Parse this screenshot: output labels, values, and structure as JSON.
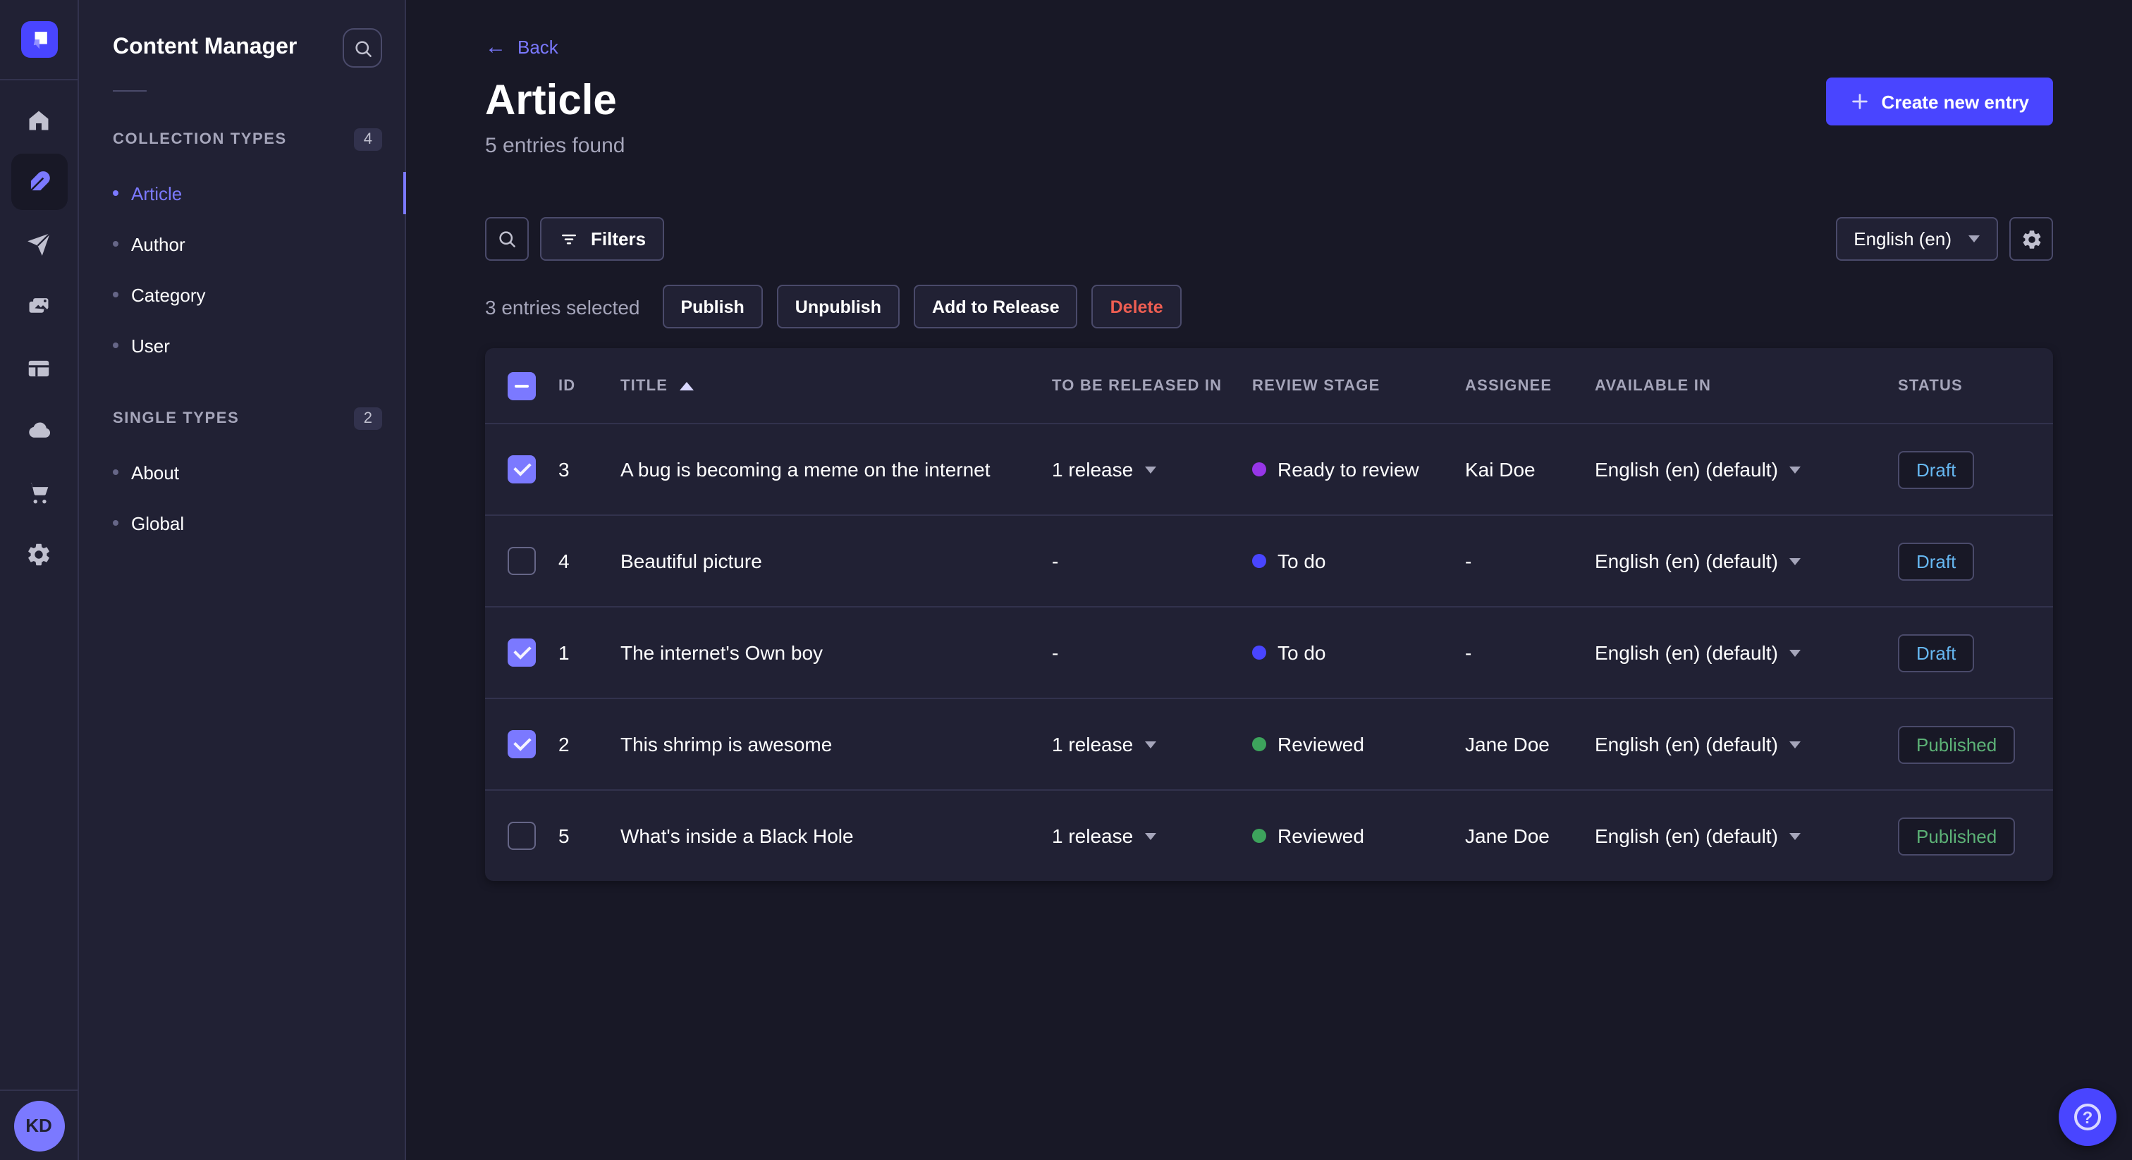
{
  "nav": {
    "logo_icon": "strapi-logo",
    "items": [
      "home-icon",
      "content-manager-feather-icon",
      "releases-paper-plane-icon",
      "media-library-images-icon",
      "content-type-builder-layout-icon",
      "deploy-cloud-icon",
      "marketplace-cart-icon",
      "settings-gear-icon"
    ],
    "active_item": "content-manager-feather-icon",
    "avatar_initials": "KD"
  },
  "subnav": {
    "title": "Content Manager",
    "search_icon": "search-icon",
    "sections": [
      {
        "label": "COLLECTION TYPES",
        "count": "4",
        "items": [
          {
            "label": "Article",
            "active": true
          },
          {
            "label": "Author",
            "active": false
          },
          {
            "label": "Category",
            "active": false
          },
          {
            "label": "User",
            "active": false
          }
        ]
      },
      {
        "label": "SINGLE TYPES",
        "count": "2",
        "items": [
          {
            "label": "About",
            "active": false
          },
          {
            "label": "Global",
            "active": false
          }
        ]
      }
    ]
  },
  "header": {
    "back_arrow": "←",
    "back_label": "Back",
    "title": "Article",
    "subtitle": "5 entries found",
    "create_button": "Create new entry"
  },
  "toolbar": {
    "search_icon": "search-icon",
    "filters_label": "Filters",
    "locale": "English (en)",
    "settings_icon": "gear-icon"
  },
  "selection": {
    "text": "3 entries selected",
    "actions": [
      "Publish",
      "Unpublish",
      "Add to Release",
      "Delete"
    ]
  },
  "table": {
    "columns": [
      "ID",
      "TITLE",
      "TO BE RELEASED IN",
      "REVIEW STAGE",
      "ASSIGNEE",
      "AVAILABLE IN",
      "STATUS"
    ],
    "sort_column": "TITLE",
    "sort_direction": "asc",
    "header_checkbox_state": "indeterminate",
    "rows": [
      {
        "checked": true,
        "id": "3",
        "title": "A bug is becoming a meme on the internet",
        "to_be_released_in": "1 release",
        "review_stage": "Ready to review",
        "stage_color": "#9736e8",
        "assignee": "Kai Doe",
        "available_in": "English (en) (default)",
        "status": "Draft"
      },
      {
        "checked": false,
        "id": "4",
        "title": "Beautiful picture",
        "to_be_released_in": "-",
        "review_stage": "To do",
        "stage_color": "#4945ff",
        "assignee": "-",
        "available_in": "English (en) (default)",
        "status": "Draft"
      },
      {
        "checked": true,
        "id": "1",
        "title": "The internet's Own boy",
        "to_be_released_in": "-",
        "review_stage": "To do",
        "stage_color": "#4945ff",
        "assignee": "-",
        "available_in": "English (en) (default)",
        "status": "Draft"
      },
      {
        "checked": true,
        "id": "2",
        "title": "This shrimp is awesome",
        "to_be_released_in": "1 release",
        "review_stage": "Reviewed",
        "stage_color": "#3da35c",
        "assignee": "Jane Doe",
        "available_in": "English (en) (default)",
        "status": "Published"
      },
      {
        "checked": false,
        "id": "5",
        "title": "What's inside a Black Hole",
        "to_be_released_in": "1 release",
        "review_stage": "Reviewed",
        "stage_color": "#3da35c",
        "assignee": "Jane Doe",
        "available_in": "English (en) (default)",
        "status": "Published"
      }
    ]
  },
  "fab": {
    "icon": "question-mark-icon",
    "question_glyph": "?"
  },
  "colors": {
    "primary": "#4945ff",
    "primary_light": "#7b79ff",
    "danger": "#ee5e52",
    "success_text": "#5cb176",
    "draft_text": "#66b7f1",
    "panel_bg": "#212134",
    "page_bg": "#181826"
  }
}
